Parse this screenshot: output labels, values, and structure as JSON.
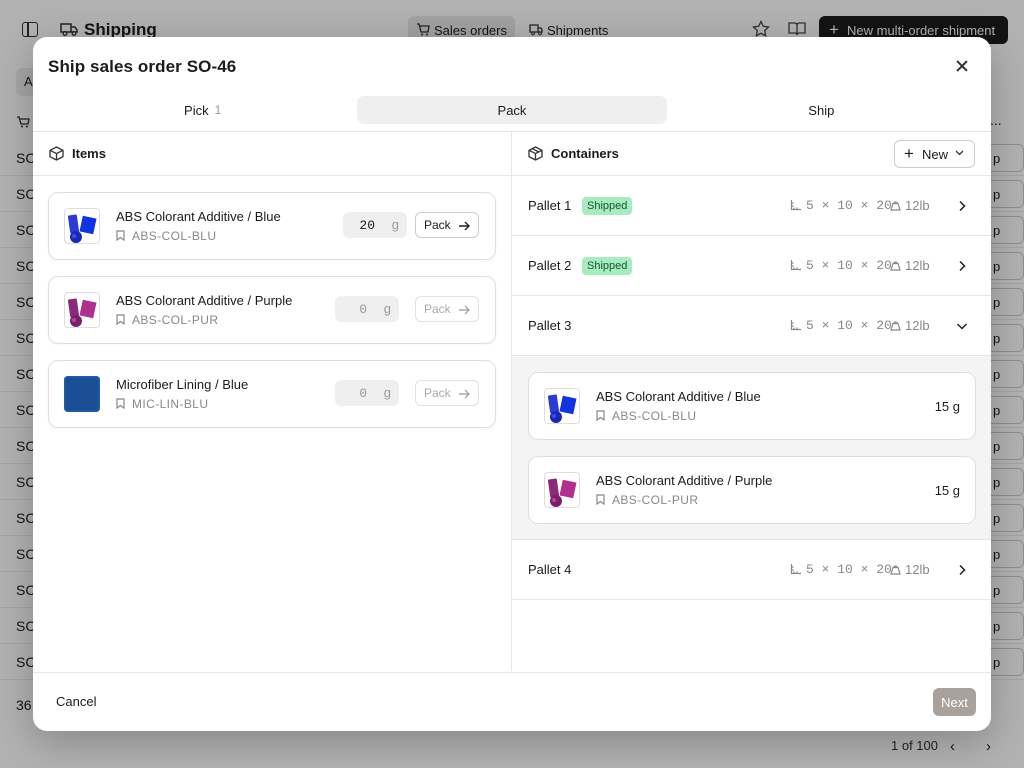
{
  "app": {
    "title": "Shipping",
    "tabs": [
      {
        "label": "Sales orders"
      },
      {
        "label": "Shipments"
      }
    ],
    "new_shipment_label": "New multi-order shipment",
    "filter_pill": "A",
    "row_codes": [
      "SC",
      "SC",
      "SC",
      "SC",
      "SC",
      "SC",
      "SC",
      "SC",
      "SC",
      "SC",
      "SC",
      "SC",
      "SC",
      "SC",
      "SC"
    ],
    "row_button": "p",
    "header_more": "...",
    "footer_count": "36",
    "pagination": "1 of 100"
  },
  "modal": {
    "title": "Ship sales order SO-46",
    "steps": [
      {
        "label": "Pick",
        "count": "1"
      },
      {
        "label": "Pack",
        "count": ""
      },
      {
        "label": "Ship",
        "count": ""
      }
    ],
    "items_title": "Items",
    "items": [
      {
        "name": "ABS Colorant Additive / Blue",
        "sku": "ABS-COL-BLU",
        "qty": "20",
        "unit": "g",
        "action": "Pack"
      },
      {
        "name": "ABS Colorant Additive / Purple",
        "sku": "ABS-COL-PUR",
        "qty": "0",
        "unit": "g",
        "action": "Pack"
      },
      {
        "name": "Microfiber Lining / Blue",
        "sku": "MIC-LIN-BLU",
        "qty": "0",
        "unit": "g",
        "action": "Pack"
      }
    ],
    "containers_title": "Containers",
    "new_label": "New",
    "pallets": [
      {
        "name": "Pallet 1",
        "badge": "Shipped",
        "dims": "5 × 10 × 20",
        "weight": "12lb"
      },
      {
        "name": "Pallet 2",
        "badge": "Shipped",
        "dims": "5 × 10 × 20",
        "weight": "12lb"
      },
      {
        "name": "Pallet 3",
        "badge": "",
        "dims": "5 × 10 × 20",
        "weight": "12lb"
      },
      {
        "name": "Pallet 4",
        "badge": "",
        "dims": "5 × 10 × 20",
        "weight": "12lb"
      }
    ],
    "pallet3_items": [
      {
        "name": "ABS Colorant Additive / Blue",
        "sku": "ABS-COL-BLU",
        "amount": "15 g"
      },
      {
        "name": "ABS Colorant Additive / Purple",
        "sku": "ABS-COL-PUR",
        "amount": "15 g"
      }
    ],
    "cancel_label": "Cancel",
    "next_label": "Next"
  },
  "colors": {
    "badge_bg": "#a9ebc0",
    "primary_dark": "#1c1c1c",
    "next_disabled": "#a9a29c"
  }
}
